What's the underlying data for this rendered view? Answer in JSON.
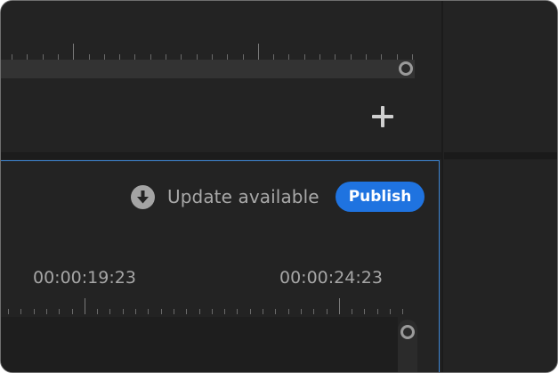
{
  "timeline": {
    "update_label": "Update available",
    "publish_label": "Publish",
    "timecodes": [
      "00:00:19:23",
      "00:00:24:23"
    ]
  },
  "icons": {
    "download": "download-circle-icon",
    "add": "plus-icon",
    "scrub_handle": "scrub-handle-icon"
  },
  "colors": {
    "background": "#232323",
    "accent": "#1f73e0",
    "focus_border": "#3f86d4",
    "text_muted": "#a8a8a8"
  }
}
